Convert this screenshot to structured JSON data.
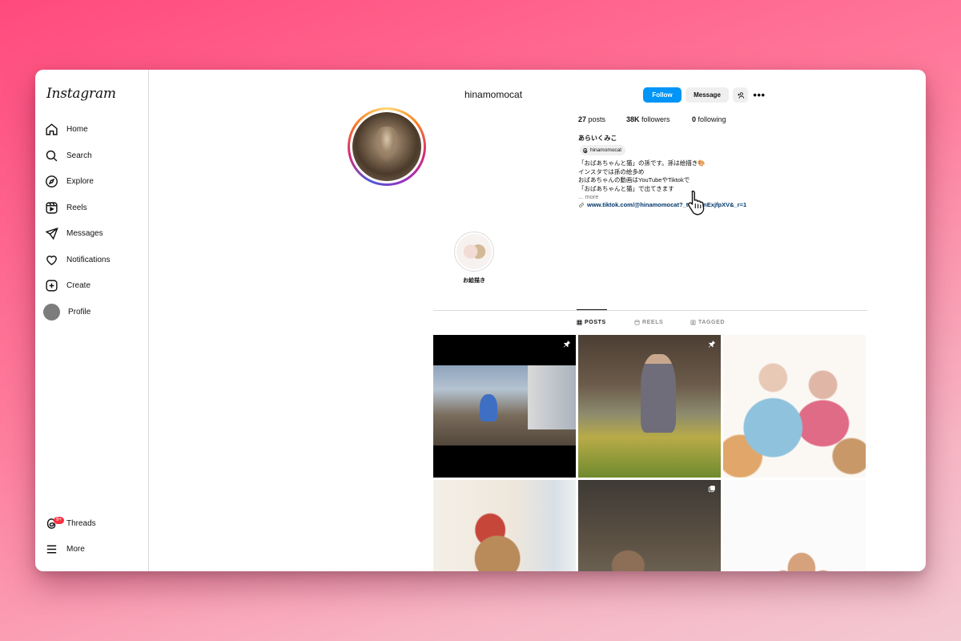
{
  "app": {
    "logo": "Instagram"
  },
  "sidebar": {
    "items": [
      {
        "label": "Home",
        "icon": "home-icon"
      },
      {
        "label": "Search",
        "icon": "search-icon"
      },
      {
        "label": "Explore",
        "icon": "compass-icon"
      },
      {
        "label": "Reels",
        "icon": "reels-icon"
      },
      {
        "label": "Messages",
        "icon": "send-icon"
      },
      {
        "label": "Notifications",
        "icon": "heart-icon"
      },
      {
        "label": "Create",
        "icon": "plus-square-icon"
      },
      {
        "label": "Profile",
        "icon": "avatar"
      }
    ],
    "bottom": [
      {
        "label": "Threads",
        "icon": "threads-icon",
        "badge": "9+"
      },
      {
        "label": "More",
        "icon": "menu-icon"
      }
    ]
  },
  "profile": {
    "username": "hinamomocat",
    "follow_label": "Follow",
    "message_label": "Message",
    "add_user_label": "+1",
    "more_label": "•••",
    "stats": {
      "posts_count": "27",
      "posts_label": "posts",
      "followers_count": "38K",
      "followers_label": "followers",
      "following_count": "0",
      "following_label": "following"
    },
    "display_name": "あらいくみこ",
    "threads_handle": "hinamomocat",
    "bio_lines": [
      "「おばあちゃんと猫」の孫です。孫は絵描き🎨",
      "インスタでは孫の絵多め",
      "おばあちゃんの動画はYouTubeやTiktokで",
      "「おばあちゃんと猫」で出てきます"
    ],
    "bio_more": "... more",
    "link": "www.tiktok.com/@hinamomocat?_t=8ownExjfpXV&_r=1"
  },
  "highlights": [
    {
      "label": "お絵描き"
    }
  ],
  "tabs": [
    {
      "label": "POSTS",
      "active": true
    },
    {
      "label": "REELS",
      "active": false
    },
    {
      "label": "TAGGED",
      "active": false
    }
  ],
  "colors": {
    "follow_button": "#0095f6",
    "link": "#00376b",
    "badge": "#ff3040"
  }
}
